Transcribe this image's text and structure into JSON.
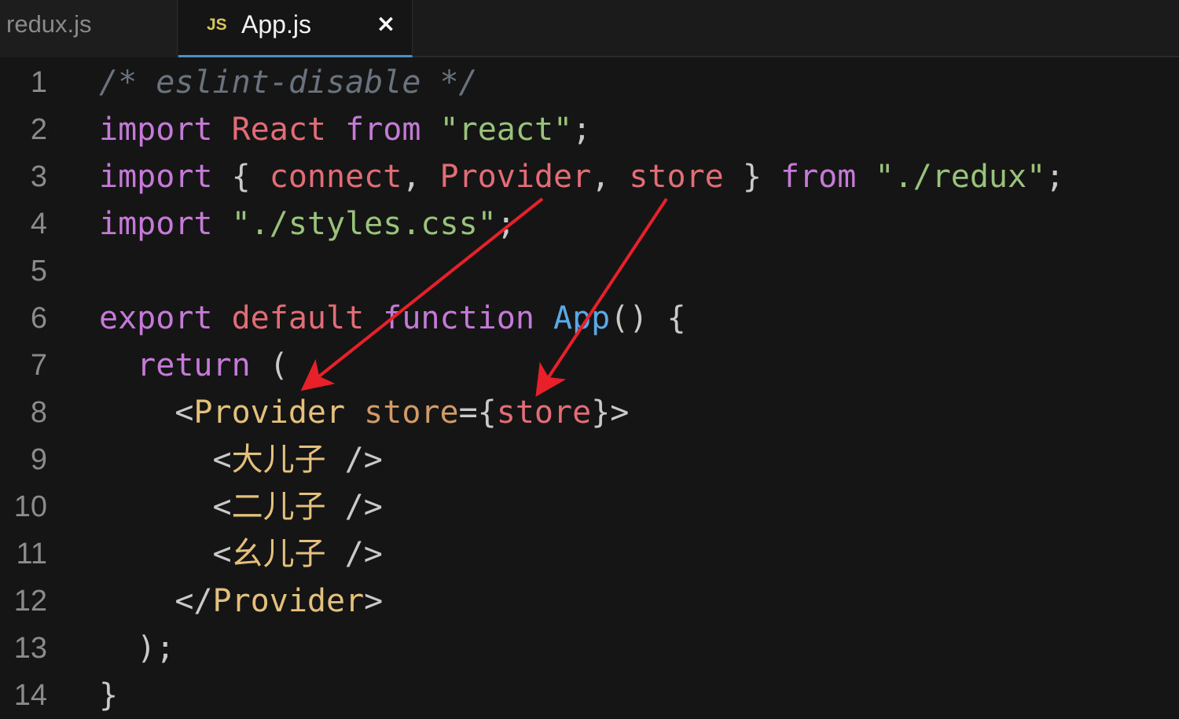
{
  "tabs": [
    {
      "label": "redux.js",
      "active": false
    },
    {
      "label": "App.js",
      "active": true,
      "icon": "JS",
      "close": "×"
    }
  ],
  "colors": {
    "background": "#151515",
    "keyword": "#c67ad8",
    "identifier": "#e36d76",
    "string": "#99c27a",
    "comment": "#6a737d",
    "function": "#5aa9e6",
    "tag": "#e5c07b",
    "arrow": "#e8202a",
    "active_tab_underline": "#4a90c9"
  },
  "lines": [
    {
      "number": "1",
      "tokens": [
        {
          "t": "/* eslint-disable */",
          "c": "cm"
        }
      ]
    },
    {
      "number": "2",
      "tokens": [
        {
          "t": "import",
          "c": "kw"
        },
        {
          "t": " ",
          "c": "pun"
        },
        {
          "t": "React",
          "c": "id"
        },
        {
          "t": " ",
          "c": "pun"
        },
        {
          "t": "from",
          "c": "kw"
        },
        {
          "t": " ",
          "c": "pun"
        },
        {
          "t": "\"react\"",
          "c": "str"
        },
        {
          "t": ";",
          "c": "pun"
        }
      ]
    },
    {
      "number": "3",
      "tokens": [
        {
          "t": "import",
          "c": "kw"
        },
        {
          "t": " { ",
          "c": "pun"
        },
        {
          "t": "connect",
          "c": "id"
        },
        {
          "t": ", ",
          "c": "pun"
        },
        {
          "t": "Provider",
          "c": "id"
        },
        {
          "t": ", ",
          "c": "pun"
        },
        {
          "t": "store",
          "c": "id"
        },
        {
          "t": " } ",
          "c": "pun"
        },
        {
          "t": "from",
          "c": "kw"
        },
        {
          "t": " ",
          "c": "pun"
        },
        {
          "t": "\"./redux\"",
          "c": "str"
        },
        {
          "t": ";",
          "c": "pun"
        }
      ]
    },
    {
      "number": "4",
      "tokens": [
        {
          "t": "import",
          "c": "kw"
        },
        {
          "t": " ",
          "c": "pun"
        },
        {
          "t": "\"./styles.css\"",
          "c": "str"
        },
        {
          "t": ";",
          "c": "pun"
        }
      ]
    },
    {
      "number": "5",
      "tokens": []
    },
    {
      "number": "6",
      "tokens": [
        {
          "t": "export",
          "c": "kw"
        },
        {
          "t": " ",
          "c": "pun"
        },
        {
          "t": "default",
          "c": "id"
        },
        {
          "t": " ",
          "c": "pun"
        },
        {
          "t": "function",
          "c": "kw"
        },
        {
          "t": " ",
          "c": "pun"
        },
        {
          "t": "App",
          "c": "fn"
        },
        {
          "t": "() {",
          "c": "pun"
        }
      ]
    },
    {
      "number": "7",
      "tokens": [
        {
          "t": "  ",
          "c": "pun"
        },
        {
          "t": "return",
          "c": "kw"
        },
        {
          "t": " (",
          "c": "pun"
        }
      ]
    },
    {
      "number": "8",
      "tokens": [
        {
          "t": "    <",
          "c": "pun"
        },
        {
          "t": "Provider",
          "c": "tag"
        },
        {
          "t": " ",
          "c": "pun"
        },
        {
          "t": "store",
          "c": "attr"
        },
        {
          "t": "={",
          "c": "pun"
        },
        {
          "t": "store",
          "c": "id"
        },
        {
          "t": "}>",
          "c": "pun"
        }
      ]
    },
    {
      "number": "9",
      "tokens": [
        {
          "t": "      <",
          "c": "pun"
        },
        {
          "t": "大儿子",
          "c": "tag"
        },
        {
          "t": " />",
          "c": "pun"
        }
      ]
    },
    {
      "number": "10",
      "tokens": [
        {
          "t": "      <",
          "c": "pun"
        },
        {
          "t": "二儿子",
          "c": "tag"
        },
        {
          "t": " />",
          "c": "pun"
        }
      ]
    },
    {
      "number": "11",
      "tokens": [
        {
          "t": "      <",
          "c": "pun"
        },
        {
          "t": "幺儿子",
          "c": "tag"
        },
        {
          "t": " />",
          "c": "pun"
        }
      ]
    },
    {
      "number": "12",
      "tokens": [
        {
          "t": "    </",
          "c": "pun"
        },
        {
          "t": "Provider",
          "c": "tag"
        },
        {
          "t": ">",
          "c": "pun"
        }
      ]
    },
    {
      "number": "13",
      "tokens": [
        {
          "t": "  );",
          "c": "pun"
        }
      ]
    },
    {
      "number": "14",
      "tokens": [
        {
          "t": "}",
          "c": "pun"
        }
      ]
    }
  ]
}
